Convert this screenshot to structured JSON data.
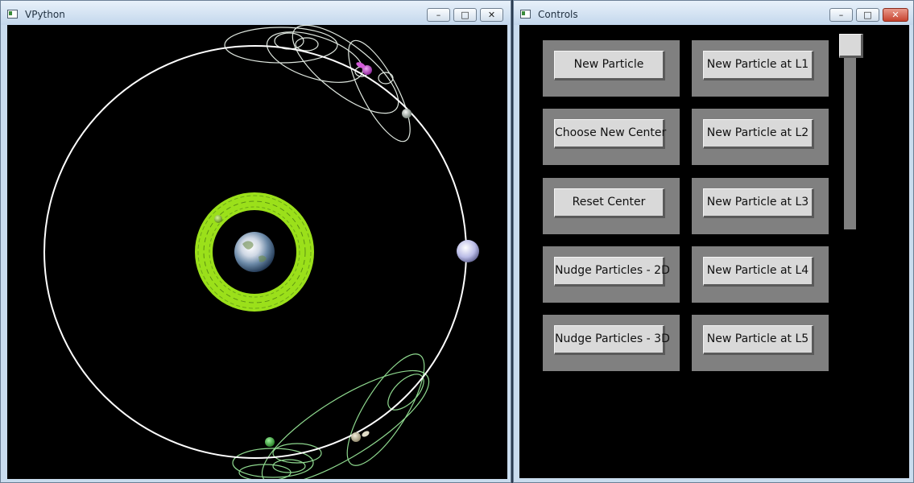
{
  "vpython_window": {
    "title": "VPython",
    "minimize_glyph": "–",
    "maximize_glyph": "□",
    "close_glyph": "✕"
  },
  "controls_window": {
    "title": "Controls",
    "minimize_glyph": "–",
    "maximize_glyph": "□",
    "close_glyph": "✕",
    "buttons": {
      "new_particle": "New Particle",
      "choose_new_center": "Choose New Center",
      "reset_center": "Reset Center",
      "nudge_2d": "Nudge Particles - 2D",
      "nudge_3d": "Nudge Particles - 3D",
      "new_l1": "New Particle at L1",
      "new_l2": "New Particle at L2",
      "new_l3": "New Particle at L3",
      "new_l4": "New Particle at L4",
      "new_l5": "New Particle at L5"
    }
  },
  "scene_colors": {
    "background": "#000000",
    "moon_orbit": "#ffffff",
    "earth_ring": "#9be01a",
    "l4_trail": "#dfe7df",
    "l5_trail": "#8ed88e",
    "moon": "#b9bbe6",
    "l4_particle": "#c94ad6",
    "l5_particle": "#3fbf3f"
  }
}
